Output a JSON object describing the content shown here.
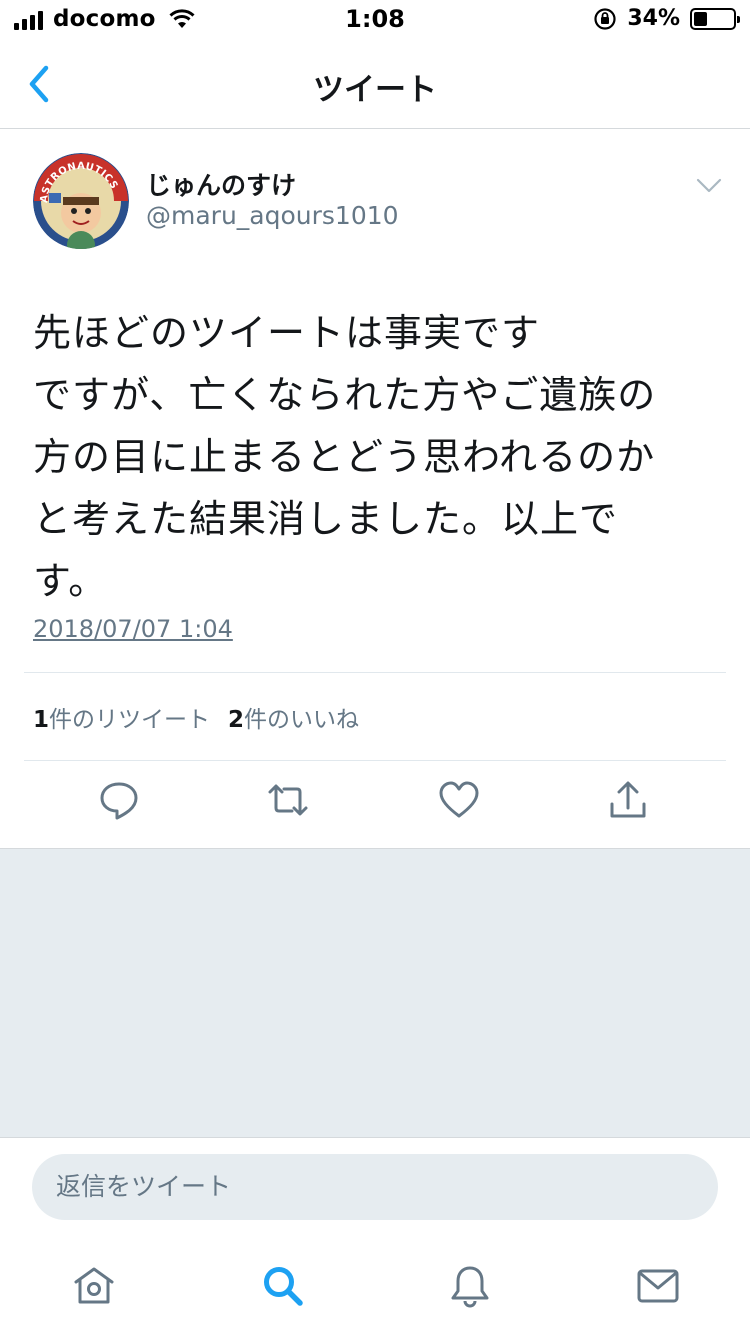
{
  "status_bar": {
    "carrier": "docomo",
    "time": "1:08",
    "battery_percent": "34%",
    "battery_level": 0.34
  },
  "nav": {
    "title": "ツイート"
  },
  "tweet": {
    "display_name": "じゅんのすけ",
    "handle": "@maru_aqours1010",
    "avatar_text": "ASTRONAUTICS",
    "text_lines": [
      "先ほどのツイートは事実です",
      "ですが、亡くなられた方やご遺族の",
      "方の目に止まるとどう思われるのか",
      "と考えた結果消しました。以上で",
      "す。"
    ],
    "timestamp": "2018/07/07 1:04",
    "retweet_count": "1",
    "retweet_label": "件のリツイート",
    "like_count": "2",
    "like_label": "件のいいね"
  },
  "reply": {
    "placeholder": "返信をツイート"
  },
  "colors": {
    "accent": "#1da1f2",
    "text": "#14171a",
    "secondary": "#657786",
    "divider": "#e1e8ed",
    "background_gray": "#e6ecf0"
  },
  "icons": [
    "back-chevron-icon",
    "caret-down-icon",
    "reply-icon",
    "retweet-icon",
    "like-icon",
    "share-icon",
    "home-icon",
    "search-icon",
    "notifications-icon",
    "messages-icon"
  ]
}
